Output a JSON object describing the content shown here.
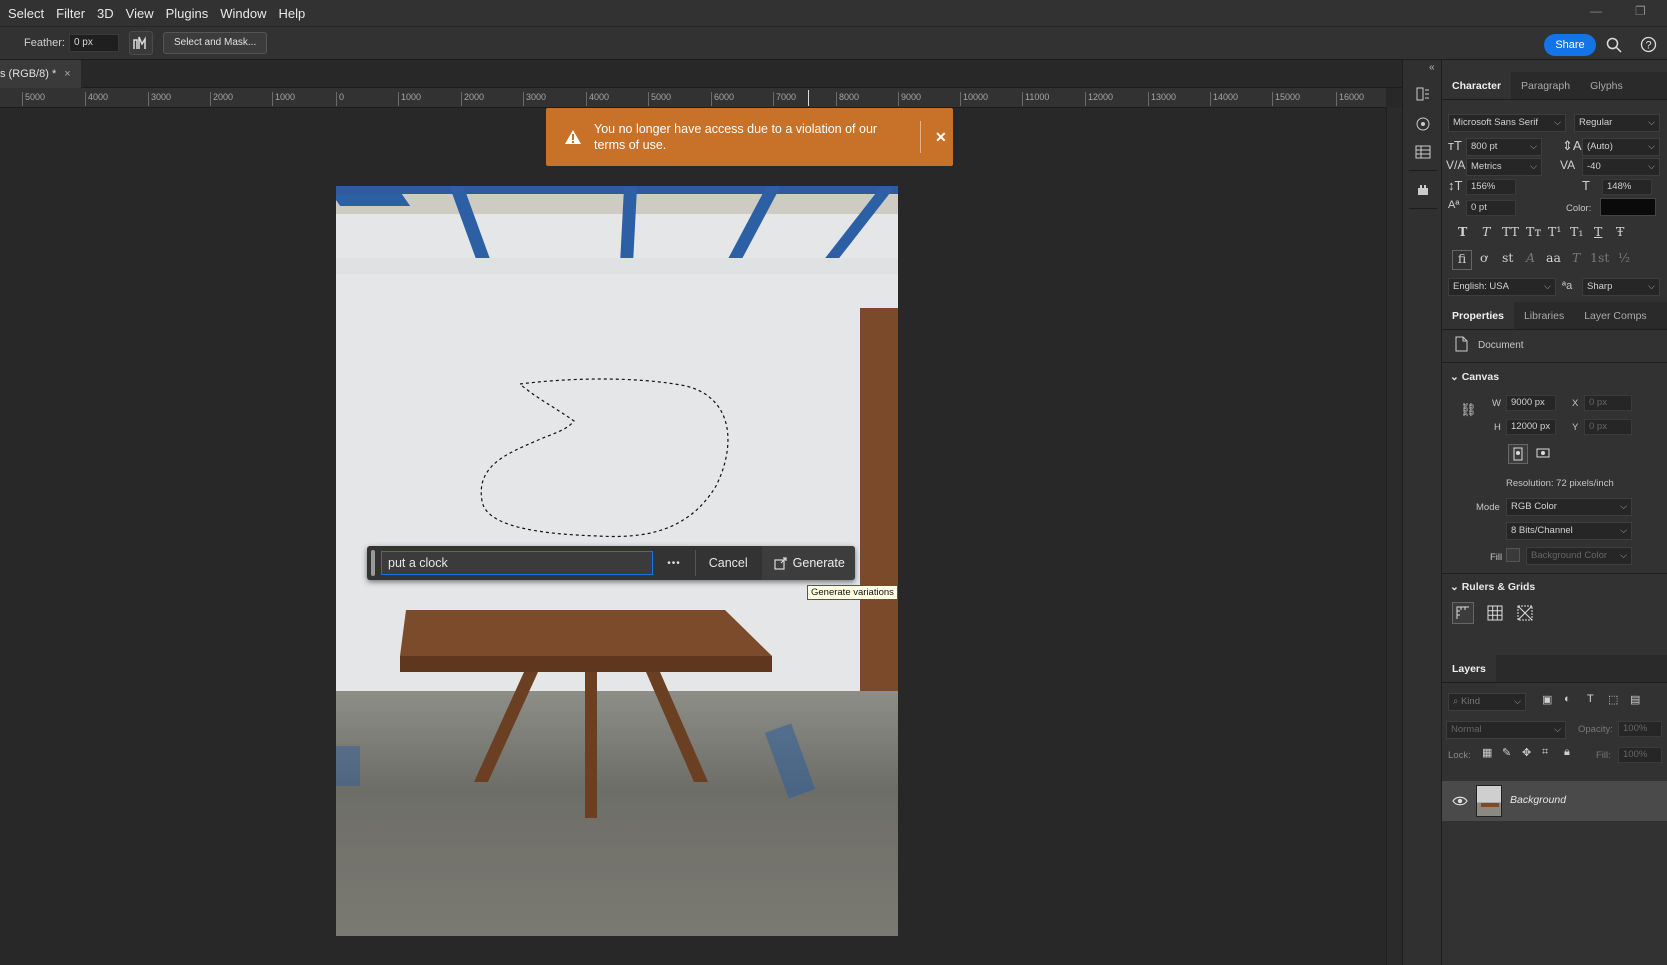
{
  "menubar": {
    "items": [
      "Select",
      "Filter",
      "3D",
      "View",
      "Plugins",
      "Window",
      "Help"
    ],
    "minimize_icon": "minimize-icon",
    "restore_icon": "restore-icon"
  },
  "options": {
    "feather_label": "Feather:",
    "feather_value": "0 px",
    "select_mask_label": "Select and Mask...",
    "share_label": "Share"
  },
  "document_tab": {
    "title": "s (RGB/8) *",
    "close_glyph": "×"
  },
  "ruler": {
    "ticks": [
      "5000",
      "4000",
      "3000",
      "2000",
      "1000",
      "0",
      "1000",
      "2000",
      "3000",
      "4000",
      "5000",
      "6000",
      "7000",
      "8000",
      "9000",
      "10000",
      "11000",
      "12000",
      "13000",
      "14000",
      "15000",
      "16000"
    ]
  },
  "toast": {
    "message": "You no longer have access due to a violation of our terms of use.",
    "close_glyph": "✕",
    "color": "#c87128"
  },
  "generative_bar": {
    "prompt_value": "put a clock",
    "more_glyph": "•••",
    "cancel_label": "Cancel",
    "generate_label": "Generate",
    "tooltip": "Generate variations"
  },
  "character_panel": {
    "tabs": [
      "Character",
      "Paragraph",
      "Glyphs"
    ],
    "font_family": "Microsoft Sans Serif",
    "font_style": "Regular",
    "font_size": "800 pt",
    "leading": "(Auto)",
    "kerning": "Metrics",
    "tracking": "-40",
    "vertical_scale": "156%",
    "horizontal_scale": "148%",
    "baseline_shift": "0 pt",
    "color_label": "Color:",
    "language": "English: USA",
    "aa_label": "ªa",
    "antialias": "Sharp",
    "style_glyphs": [
      "T",
      "T",
      "TT",
      "Tт",
      "T¹",
      "T₁",
      "T",
      "Ŧ"
    ],
    "opentype_glyphs": [
      "ﬁ",
      "ơ",
      "st",
      "A",
      "aa",
      "T",
      "1st",
      "½"
    ]
  },
  "properties_panel": {
    "tabs": [
      "Properties",
      "Libraries",
      "Layer Comps"
    ],
    "document_label": "Document",
    "canvas_title": "Canvas",
    "w_label": "W",
    "w_value": "9000 px",
    "h_label": "H",
    "h_value": "12000 px",
    "x_label": "X",
    "x_value": "0 px",
    "y_label": "Y",
    "y_value": "0 px",
    "resolution": "Resolution: 72 pixels/inch",
    "mode_label": "Mode",
    "mode_value": "RGB Color",
    "bits_value": "8 Bits/Channel",
    "fill_label": "Fill",
    "fill_value": "Background Color",
    "rulers_title": "Rulers & Grids"
  },
  "layers_panel": {
    "tab": "Layers",
    "kind_placeholder": "Kind",
    "blend_mode": "Normal",
    "opacity_label": "Opacity:",
    "opacity_value": "100%",
    "lock_label": "Lock:",
    "fill_label": "Fill:",
    "fill_value": "100%",
    "layer_name": "Background"
  }
}
